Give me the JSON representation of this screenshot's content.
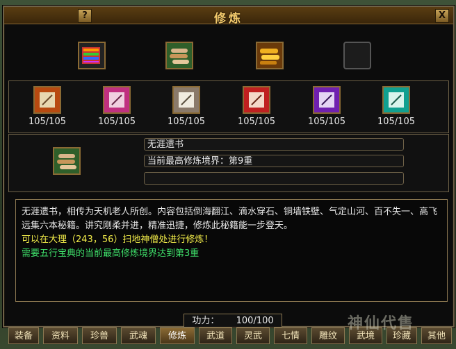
{
  "window": {
    "title": "修炼",
    "help_label": "?",
    "close_label": "X"
  },
  "top_items": [
    {
      "icon": "book-rainbow-icon"
    },
    {
      "icon": "scroll-bundle-green-icon"
    },
    {
      "icon": "gold-scroll-bundle-icon"
    },
    {
      "icon": "empty-slot-icon"
    }
  ],
  "scrolls": [
    {
      "icon": "scroll-orange-icon",
      "count": "105/105"
    },
    {
      "icon": "scroll-pink-icon",
      "count": "105/105"
    },
    {
      "icon": "scroll-white-icon",
      "count": "105/105"
    },
    {
      "icon": "scroll-red-icon",
      "count": "105/105"
    },
    {
      "icon": "scroll-purple-icon",
      "count": "105/105"
    },
    {
      "icon": "scroll-cyan-icon",
      "count": "105/105"
    }
  ],
  "selected": {
    "name": "无涯遗书",
    "level": "当前最高修炼境界：第9重",
    "extra": ""
  },
  "description": {
    "line1": "无涯遗书，相传为天机老人所创。内容包括倒海翻江、滴水穿石、铜墙铁壁、气定山河、百不失一、高飞远集六本秘籍。讲究刚柔并进，精准迅捷，修炼此秘籍能一步登天。",
    "line2": "可以在大理（243，56）扫地神僧处进行修炼！",
    "line3": "需要五行宝典的当前最高修炼境界达到第3重"
  },
  "gongli": {
    "label": "功力：",
    "value": "100/100"
  },
  "tabs": [
    "装备",
    "资料",
    "珍兽",
    "武魂",
    "修炼",
    "武道",
    "灵武",
    "七情",
    "雕纹",
    "武境",
    "珍藏",
    "其他"
  ],
  "watermark": "神仙代售",
  "colors": {
    "desc_white": "#e8e8e8",
    "desc_yellow": "#f4ee4a",
    "desc_green": "#3fe06a"
  }
}
